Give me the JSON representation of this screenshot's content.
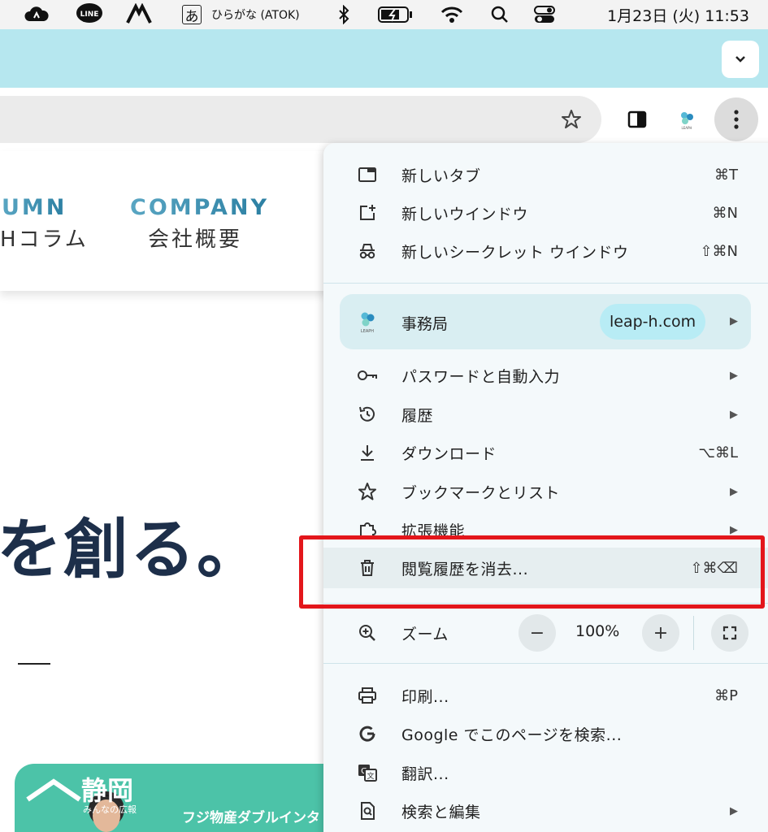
{
  "menubar": {
    "ime_char": "あ",
    "ime_label": "ひらがな (ATOK)",
    "line_label": "LINE",
    "datetime": "1月23日 (火)  11:53"
  },
  "page": {
    "nav": [
      {
        "en": "UMN",
        "ja": "Hコラム"
      },
      {
        "en": "COMPANY",
        "ja": "会社概要"
      }
    ],
    "hero": "を創る。",
    "banner": {
      "title": "静岡",
      "subtitle": "みんなの広報",
      "text": "フジ物産ダブルインタ"
    }
  },
  "menu": {
    "items": [
      {
        "icon": "new-tab-icon",
        "label": "新しいタブ",
        "shortcut": "⌘T"
      },
      {
        "icon": "new-window-icon",
        "label": "新しいウインドウ",
        "shortcut": "⌘N"
      },
      {
        "icon": "incognito-icon",
        "label": "新しいシークレット ウインドウ",
        "shortcut": "⇧⌘N"
      }
    ],
    "profile": {
      "name": "事務局",
      "site": "leap-h.com"
    },
    "items2": [
      {
        "icon": "key-icon",
        "label": "パスワードと自動入力",
        "shortcut": ""
      },
      {
        "icon": "history-icon",
        "label": "履歴",
        "shortcut": ""
      },
      {
        "icon": "download-icon",
        "label": "ダウンロード",
        "shortcut": "⌥⌘L"
      },
      {
        "icon": "bookmark-star-icon",
        "label": "ブックマークとリスト",
        "shortcut": ""
      },
      {
        "icon": "extension-icon",
        "label": "拡張機能",
        "shortcut": ""
      },
      {
        "icon": "trash-icon",
        "label": "閲覧履歴を消去...",
        "shortcut": "⇧⌘⌫"
      }
    ],
    "zoom": {
      "label": "ズーム",
      "minus": "−",
      "value": "100%",
      "plus": "+"
    },
    "items3": [
      {
        "icon": "print-icon",
        "label": "印刷...",
        "shortcut": "⌘P"
      },
      {
        "icon": "google-icon",
        "label": "Google でこのページを検索...",
        "shortcut": ""
      },
      {
        "icon": "translate-icon",
        "label": "翻訳...",
        "shortcut": ""
      },
      {
        "icon": "search-edit-icon",
        "label": "検索と編集",
        "shortcut": ""
      }
    ]
  },
  "colors": {
    "tabstrip": "#b6e7ef",
    "highlight": "#e3161b",
    "banner": "#4cc3a8"
  }
}
